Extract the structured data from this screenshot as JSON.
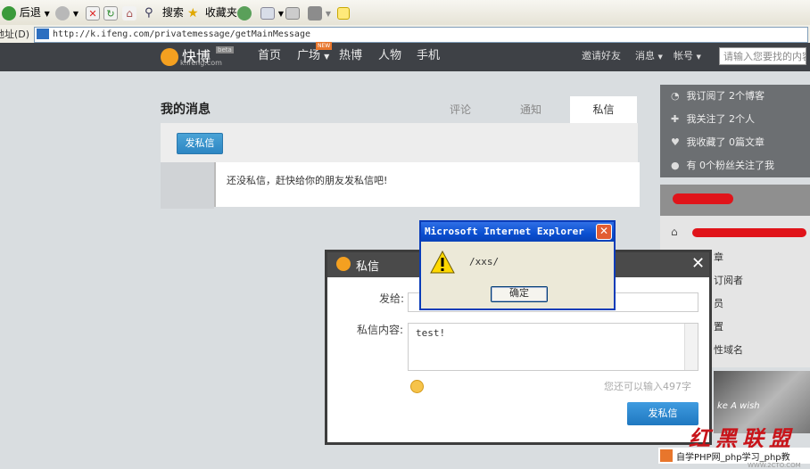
{
  "browser": {
    "back_label": "后退",
    "search_label": "搜索",
    "favorites_label": "收藏夹",
    "address_label": "地址(D)",
    "url": "http://k.ifeng.com/privatemessage/getMainMessage"
  },
  "site": {
    "logo_text": "快博",
    "logo_badge": "beta",
    "logo_domain": "k.ifeng.com",
    "nav": [
      "首页",
      "广场",
      "热博",
      "人物",
      "手机"
    ],
    "nav_new_badge": "NEW",
    "right_links": [
      "邀请好友",
      "消息",
      "帐号"
    ],
    "search_placeholder": "请输入您要找的内容"
  },
  "messages": {
    "title": "我的消息",
    "tabs": [
      "评论",
      "通知",
      "私信"
    ],
    "active_tab": "私信",
    "new_button": "发私信",
    "empty_text": "还没私信，赶快给你的朋友发私信吧!"
  },
  "sidebar": {
    "stats": [
      {
        "icon": "rss-icon",
        "text": "我订阅了 2个博客"
      },
      {
        "icon": "plus-icon",
        "text": "我关注了 2个人"
      },
      {
        "icon": "heart-icon",
        "text": "我收藏了 0篇文章"
      },
      {
        "icon": "person-icon",
        "text": "有 0个粉丝关注了我"
      }
    ],
    "list": [
      "章",
      "订阅者",
      "员",
      "置",
      "性域名"
    ],
    "banner_text": "ke A wish"
  },
  "dialog": {
    "title": "私信",
    "to_label": "发给:",
    "content_label": "私信内容:",
    "content_value": "test!",
    "remaining": "您还可以输入497字",
    "send_button": "发私信"
  },
  "alert": {
    "title": "Microsoft Internet Explorer",
    "message": "/xxs/",
    "ok_label": "确定"
  },
  "watermark": {
    "text": "红黑联盟",
    "subtext": "自学PHP网_php学习_php教",
    "url": "WWW.2CTO.COM"
  }
}
